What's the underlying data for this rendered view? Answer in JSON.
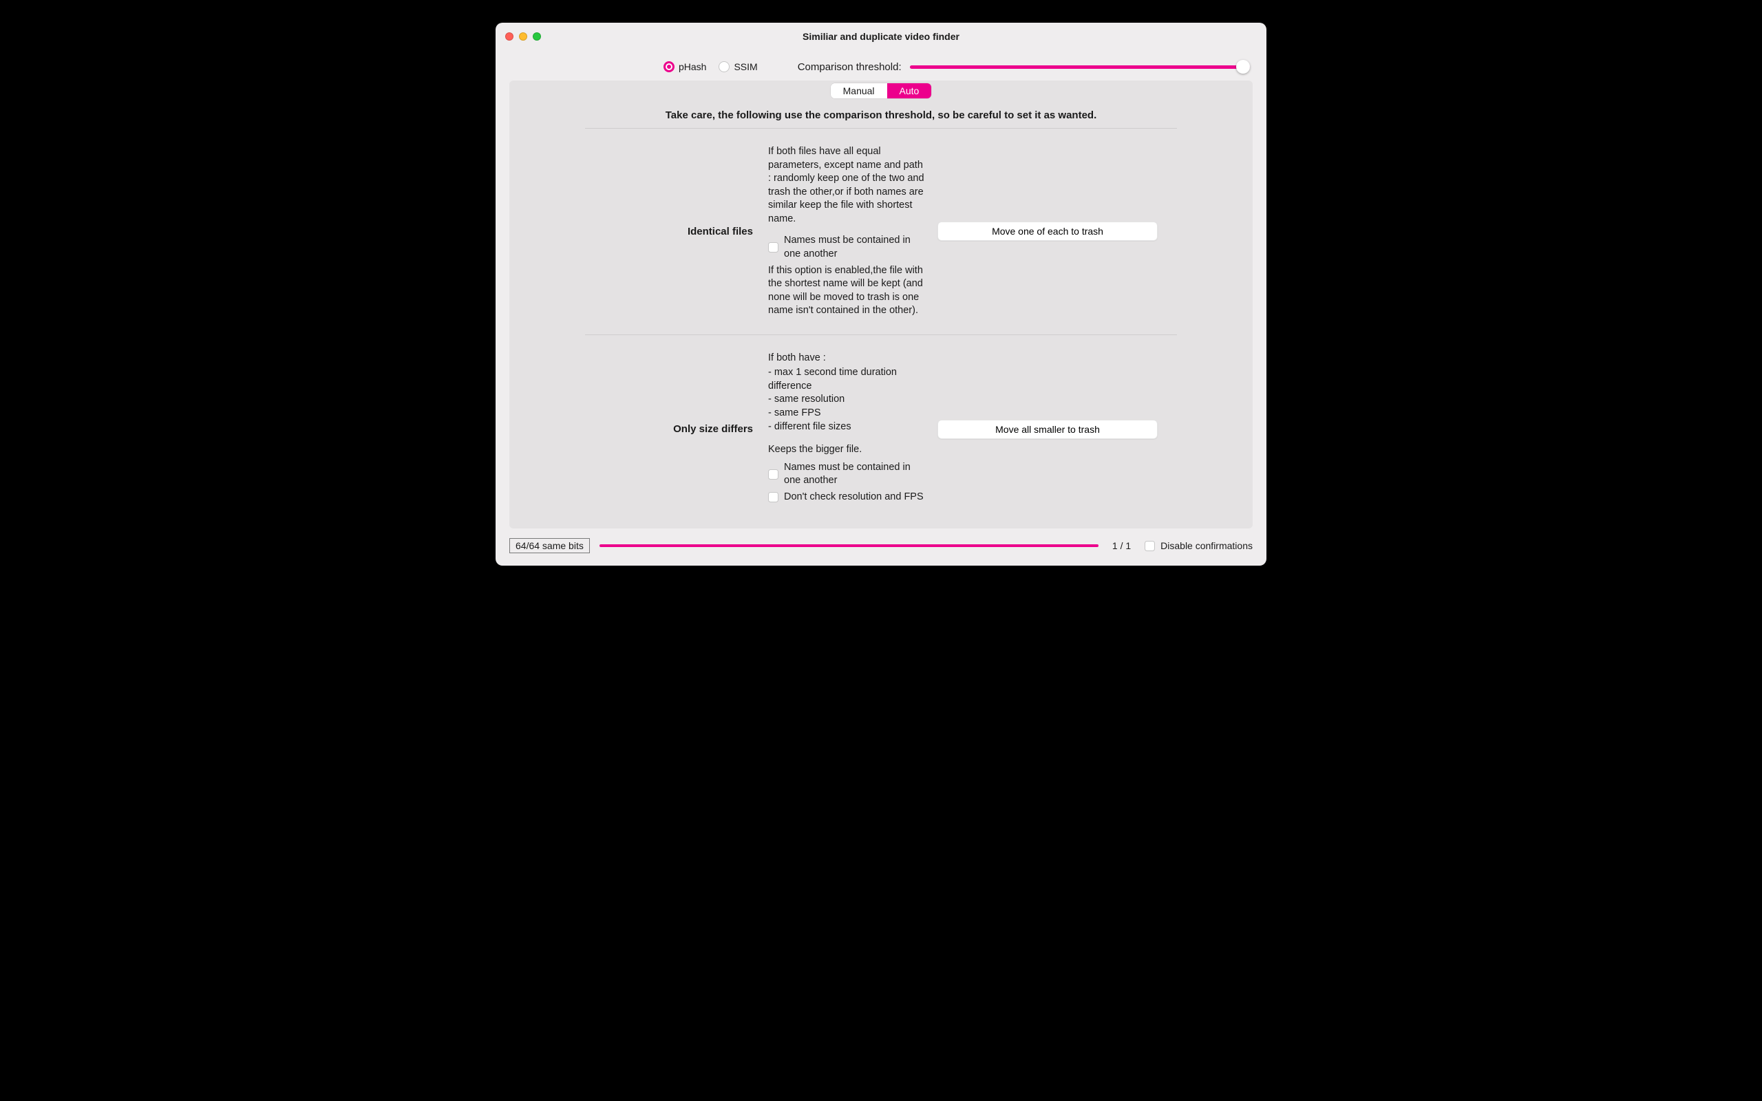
{
  "window": {
    "title": "Similiar and duplicate video finder"
  },
  "toolbar": {
    "radios": {
      "phash": "pHash",
      "ssim": "SSIM",
      "selected": "phash"
    },
    "threshold_label": "Comparison threshold:"
  },
  "tabs": {
    "manual": "Manual",
    "auto": "Auto",
    "active": "auto"
  },
  "warning": "Take care, the following use the comparison threshold, so be careful to set it as wanted.",
  "sections": {
    "identical": {
      "label": "Identical files",
      "desc1": "If both files have all equal parameters, except name and path : randomly keep one of the two and trash the other,or if both names are similar keep the file with shortest name.",
      "chk_names": "Names must be contained in one another",
      "desc2": "If this option is enabled,the file with the shortest name will be kept (and none will be moved to trash is one name isn't contained in the other).",
      "action": "Move one of each to trash"
    },
    "size": {
      "label": "Only size differs",
      "desc_intro": "If both have :",
      "b1": " - max 1 second time duration difference",
      "b2": " - same resolution",
      "b3": " - same FPS",
      "b4": " - different file sizes",
      "desc_keeps": "Keeps the bigger file.",
      "chk_names": "Names must be contained in one another",
      "chk_res": "Don't check resolution and FPS",
      "action": "Move all smaller to trash"
    }
  },
  "footer": {
    "bits": "64/64 same bits",
    "counter": "1  /  1",
    "disable": "Disable confirmations"
  }
}
